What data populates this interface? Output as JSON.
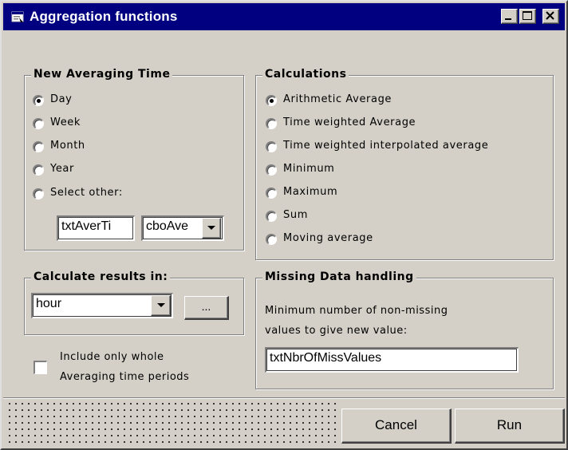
{
  "window": {
    "title": "Aggregation functions",
    "icon": "form-icon",
    "controls": [
      "minimize-icon",
      "maximize-icon",
      "close-icon"
    ]
  },
  "averaging_time": {
    "title": "New Averaging Time",
    "options": [
      "Day",
      "Week",
      "Month",
      "Year",
      "Select other:"
    ],
    "selected": "Day",
    "text_value": "txtAverTi",
    "combo_value": "cboAve"
  },
  "calculations": {
    "title": "Calculations",
    "options": [
      "Arithmetic Average",
      "Time weighted Average",
      "Time weighted interpolated average",
      "Minimum",
      "Maximum",
      "Sum",
      "Moving average"
    ],
    "selected": "Arithmetic Average"
  },
  "results": {
    "title": "Calculate results in:",
    "combo_value": "hour",
    "browse_label": "..."
  },
  "missing": {
    "title": "Missing Data handling",
    "desc_line1": "Minimum number of non-missing",
    "desc_line2": "values to give new value:",
    "text_value": "txtNbrOfMissValues"
  },
  "checkbox": {
    "line1": "Include only whole",
    "line2": "Averaging time periods",
    "checked": false
  },
  "buttons": {
    "cancel": "Cancel",
    "run": "Run"
  },
  "colors": {
    "titlebar": "#000080",
    "face": "#d4d0c8"
  }
}
